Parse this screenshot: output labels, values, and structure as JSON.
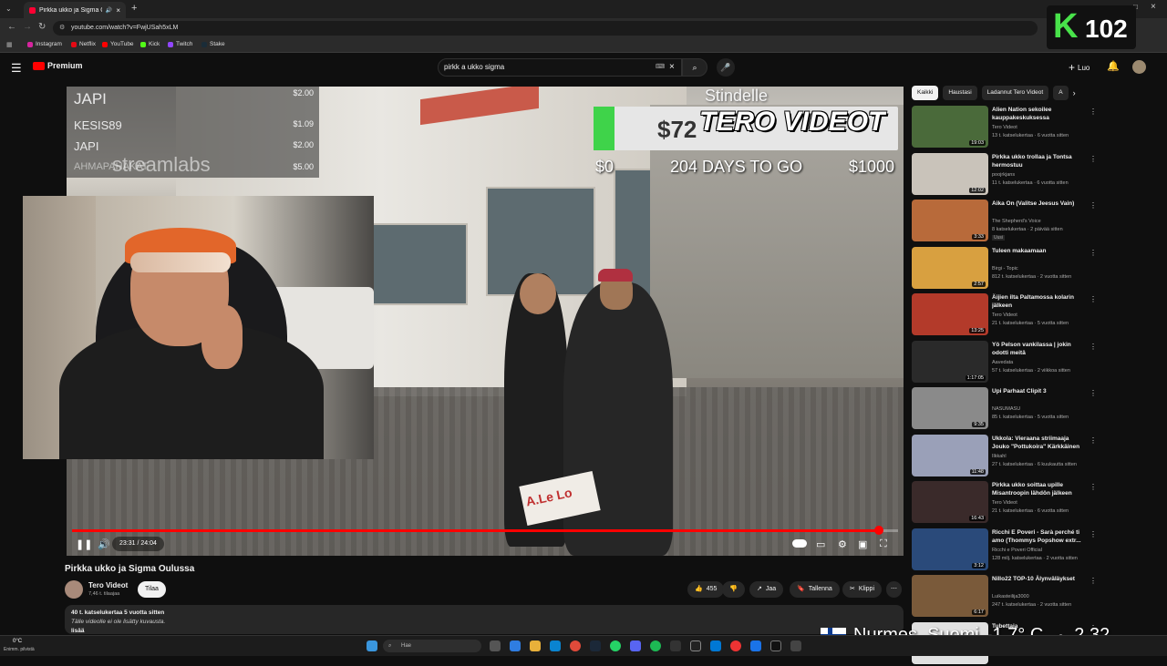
{
  "browser": {
    "tab_title": "Pirkka ukko ja Sigma Oulus",
    "url": "youtube.com/watch?v=FwjUSah5xLM",
    "bookmarks": [
      "Instagram",
      "Netflix",
      "YouTube",
      "Kick",
      "Twitch",
      "Stake"
    ]
  },
  "header": {
    "logo": "Premium",
    "search_value": "pirkk a ukko sigma",
    "create_label": "Luo"
  },
  "overlay": {
    "k_letter": "K",
    "k_number": "102",
    "streamlabs": "streamlabs",
    "stindelle": "Stindelle",
    "goal_amount": "$72",
    "tero_videot": "TERO VIDEOT",
    "goal_start": "$0",
    "goal_days": "204 DAYS TO GO",
    "goal_end": "$1000",
    "goal_progress": 0.07,
    "donations": [
      {
        "name": "JAPI",
        "amount": "$2.00"
      },
      {
        "name": "KESIS89",
        "amount": "$1.09"
      },
      {
        "name": "JAPI",
        "amount": "$2.00"
      },
      {
        "name": "AHMAPAHAKAT",
        "amount": "$5.00"
      }
    ],
    "sign_text": "A.Le Lo"
  },
  "player": {
    "time": "23:31 / 24:04",
    "progress": 0.977
  },
  "video": {
    "title": "Pirkka ukko ja Sigma Oulussa",
    "channel": "Tero Videot",
    "subs": "7,46 t. tilaajaa",
    "subscribe": "Tilaa",
    "likes": "455",
    "share": "Jaa",
    "save": "Tallenna",
    "clip": "Klippi",
    "views_age": "40 t. katselukertaa  5 vuotta sitten",
    "desc_line": "Tälle videolle ei ole lisätty kuvausta.",
    "more": "lisää"
  },
  "sidebar": {
    "chips": [
      "Kaikki",
      "Haustasi",
      "Ladannut Tero Videot",
      "A"
    ],
    "recs": [
      {
        "title": "Alien Nation sekoilee kauppakeskuksessa",
        "channel": "Tero Videot",
        "meta": "13 t. katselukertaa · 6 vuotta sitten",
        "duration": "19:03",
        "color": "#4a6a3a"
      },
      {
        "title": "Pirkka ukko trollaa ja Tontsa hermostuu",
        "channel": "poojrkjans",
        "meta": "11 t. katselukertaa · 6 vuotta sitten",
        "duration": "12:02",
        "color": "#c9c3ba"
      },
      {
        "title": "Aika On (Valitse Jeesus Vain)",
        "channel": "The Shepherd's Voice",
        "meta": "8 katselukertaa · 2 päivää sitten",
        "duration": "3:33",
        "badge": "Uusi",
        "color": "#b86a3a"
      },
      {
        "title": "Tuleen makaamaan",
        "channel": "Birgi - Topic",
        "meta": "812 t. katselukertaa · 2 vuotta sitten",
        "duration": "2:57",
        "color": "#d8a040"
      },
      {
        "title": "Äijien ilta Paltamossa kolarin jälkeen",
        "channel": "Tero Videot",
        "meta": "21 t. katselukertaa · 5 vuotta sitten",
        "duration": "13:25",
        "color": "#b33a2a"
      },
      {
        "title": "Yö Pelson vankilassa | jokin odotti meitä",
        "channel": "Aavedata",
        "meta": "57 t. katselukertaa · 2 viikkoa sitten",
        "duration": "1:17:05",
        "color": "#2a2a2a"
      },
      {
        "title": "Upi Parhaat Clipit 3",
        "channel": "NASUMASU",
        "meta": "85 t. katselukertaa · 5 vuotta sitten",
        "duration": "9:35",
        "color": "#8a8a8a"
      },
      {
        "title": "Ukkola: Vieraana striimaaja Jouko \"Pottukoira\" Kärkkäinen",
        "channel": "Ilkkahl",
        "meta": "27 t. katselukertaa · 6 kuukautta sitten",
        "duration": "11:48",
        "color": "#9aa0b8"
      },
      {
        "title": "Pirkka ukko soittaa upille Misantroopin lähdön jälkeen",
        "channel": "Tero Videot",
        "meta": "21 t. katselukertaa · 6 vuotta sitten",
        "duration": "16:43",
        "color": "#3a2a2a"
      },
      {
        "title": "Ricchi E Poveri - Sarà perché ti amo (Thommys Popshow extr...",
        "channel": "Ricchi e Poveri Official",
        "meta": "128 milj. katselukertaa · 2 vuotta sitten",
        "duration": "3:12",
        "color": "#2a4a7a"
      },
      {
        "title": "Nillo22 TOP-10 Älynväläykset",
        "channel": "Luikasteilija3000",
        "meta": "247 t. katselukertaa · 2 vuotta sitten",
        "duration": "6:17",
        "color": "#7a5a3a"
      },
      {
        "title": "Tubettaja",
        "channel": "",
        "meta": "",
        "duration": "",
        "color": "#e0e0e0"
      }
    ]
  },
  "taskbar": {
    "weather_temp": "0°C",
    "weather_desc": "Enimm. pilvistä",
    "search_placeholder": "Hae",
    "location": "Nurmes, Suomi",
    "temp_big": "-1.7° C",
    "clock": "2.32"
  }
}
